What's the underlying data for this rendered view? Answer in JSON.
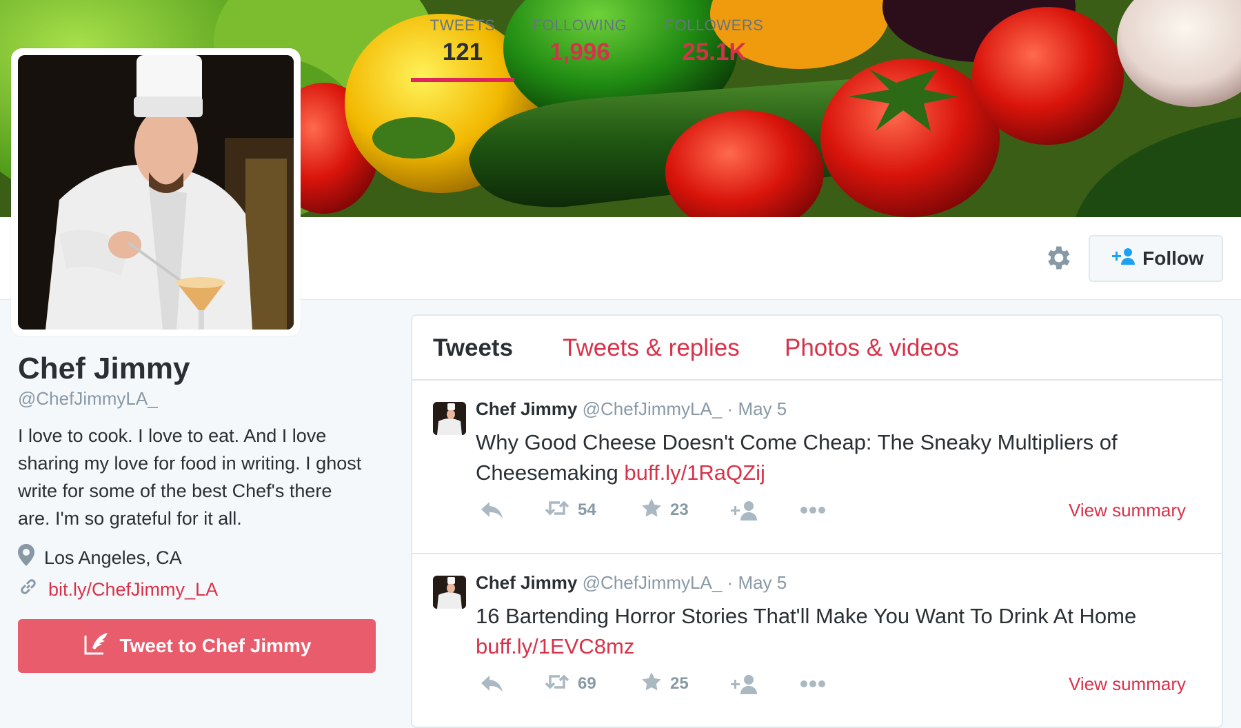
{
  "profile": {
    "name": "Chef Jimmy",
    "handle": "@ChefJimmyLA_",
    "bio": "I love to cook. I love to eat. And I love sharing my love for food in writing. I ghost write for some of the best Chef's there are. I'm so grateful for it all.",
    "location": "Los Angeles, CA",
    "url": "bit.ly/ChefJimmy_LA",
    "tweet_to_label": "Tweet to Chef Jimmy"
  },
  "stats": [
    {
      "label": "TWEETS",
      "value": "121"
    },
    {
      "label": "FOLLOWING",
      "value": "1,996"
    },
    {
      "label": "FOLLOWERS",
      "value": "25.1K"
    }
  ],
  "follow_label": "Follow",
  "tabs": [
    "Tweets",
    "Tweets & replies",
    "Photos & videos"
  ],
  "tweets": [
    {
      "name": "Chef Jimmy",
      "handle": "@ChefJimmyLA_",
      "dot": "·",
      "date": "May 5",
      "text": "Why Good Cheese Doesn't Come Cheap: The Sneaky Multipliers of Cheesemaking",
      "link": "buff.ly/1RaQZij",
      "retweets": "54",
      "favorites": "23",
      "view_summary": "View summary"
    },
    {
      "name": "Chef Jimmy",
      "handle": "@ChefJimmyLA_",
      "dot": "·",
      "date": "May 5",
      "text": "16 Bartending Horror Stories That'll Make You Want To Drink At Home",
      "link": "buff.ly/1EVC8mz",
      "retweets": "69",
      "favorites": "25",
      "view_summary": "View summary"
    }
  ],
  "colors": {
    "accent": "#d8324a",
    "tweet_button": "#e95c6c",
    "border": "#e1e8ed",
    "muted": "#8899a6"
  },
  "icons": [
    "gear-icon",
    "add-user-icon",
    "location-pin-icon",
    "link-icon",
    "quill-icon",
    "reply-icon",
    "retweet-icon",
    "star-icon",
    "follow-small-icon",
    "more-icon"
  ]
}
